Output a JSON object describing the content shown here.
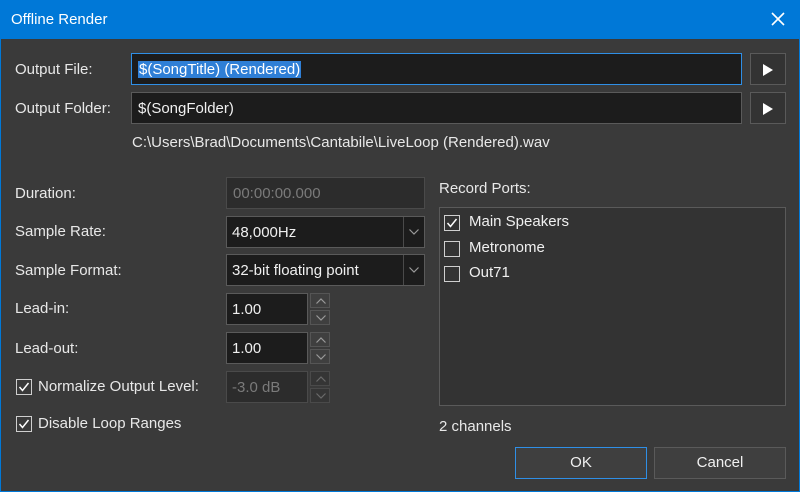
{
  "window": {
    "title": "Offline Render"
  },
  "output_file": {
    "label": "Output File:",
    "value": "$(SongTitle) (Rendered)"
  },
  "output_folder": {
    "label": "Output Folder:",
    "value": "$(SongFolder)"
  },
  "resolved_path": "C:\\Users\\Brad\\Documents\\Cantabile\\LiveLoop (Rendered).wav",
  "duration": {
    "label": "Duration:",
    "value": "00:00:00.000"
  },
  "sample_rate": {
    "label": "Sample Rate:",
    "value": "48,000Hz"
  },
  "sample_format": {
    "label": "Sample Format:",
    "value": "32-bit floating point"
  },
  "lead_in": {
    "label": "Lead-in:",
    "value": "1.00"
  },
  "lead_out": {
    "label": "Lead-out:",
    "value": "1.00"
  },
  "normalize": {
    "label": "Normalize Output Level:",
    "checked": true,
    "value": "-3.0 dB"
  },
  "disable_loop": {
    "label": "Disable Loop Ranges",
    "checked": true
  },
  "record_ports": {
    "label": "Record Ports:",
    "items": [
      {
        "label": "Main Speakers",
        "checked": true
      },
      {
        "label": "Metronome",
        "checked": false
      },
      {
        "label": "Out71",
        "checked": false
      }
    ],
    "channels_text": "2 channels"
  },
  "buttons": {
    "ok": "OK",
    "cancel": "Cancel"
  }
}
